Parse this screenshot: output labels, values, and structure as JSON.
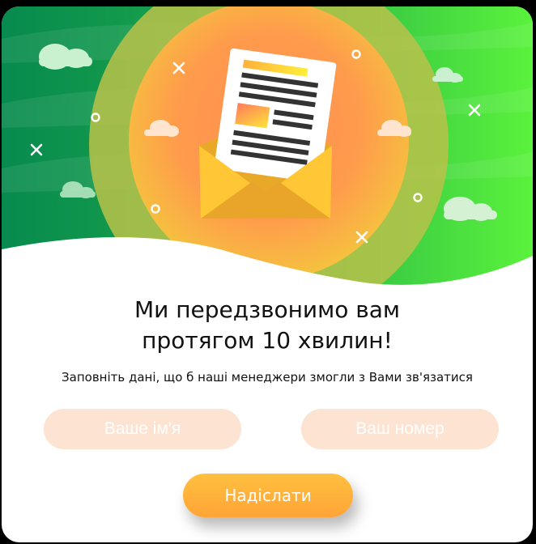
{
  "popup": {
    "title_line1": "Ми передзвонимо вам",
    "title_line2": "протягом 10 хвилин!",
    "subtitle": "Заповніть дані, що б наші менеджери змогли з Вами зв'язатися",
    "name_placeholder": "Ваше ім'я",
    "phone_placeholder": "Ваш номер",
    "submit_label": "Надіслати"
  },
  "colors": {
    "green_dark": "#0a8a4a",
    "green_light": "#57e63a",
    "orange": "#ff8c50",
    "yellow": "#ffc93a",
    "field_bg": "#fde3d2",
    "button": "#ffb43c"
  },
  "illustration": {
    "icon": "envelope-with-letter-icon"
  }
}
